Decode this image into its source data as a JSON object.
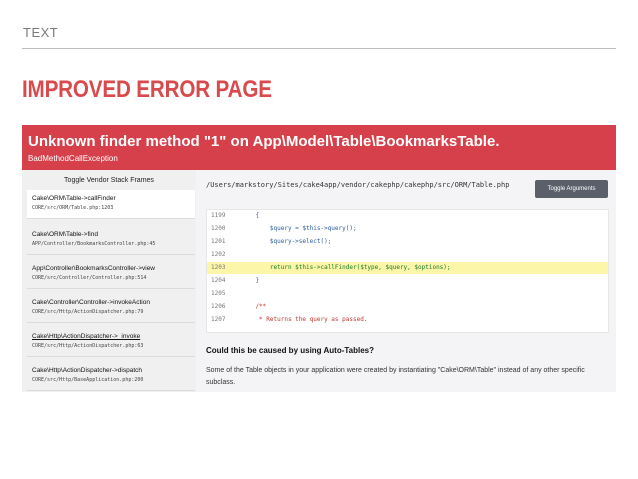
{
  "slide": {
    "tag": "TEXT",
    "title": "IMPROVED ERROR PAGE"
  },
  "error": {
    "title": "Unknown finder method \"1\" on App\\Model\\Table\\BookmarksTable.",
    "type": "BadMethodCallException"
  },
  "sidebar": {
    "toggle_label": "Toggle Vendor Stack Frames",
    "frames": [
      {
        "name": "Cake\\ORM\\Table->callFinder",
        "file": "CORE/src/ORM/Table.php:1203"
      },
      {
        "name": "Cake\\ORM\\Table->find",
        "file": "APP/Controller/BookmarksController.php:45"
      },
      {
        "name": "App\\Controller\\BookmarksController->view",
        "file": "CORE/src/Controller/Controller.php:514"
      },
      {
        "name": "Cake\\Controller\\Controller->invokeAction",
        "file": "CORE/src/Http/ActionDispatcher.php:79"
      },
      {
        "name": "Cake\\Http\\ActionDispatcher->_invoke",
        "file": "CORE/src/Http/ActionDispatcher.php:63"
      },
      {
        "name": "Cake\\Http\\ActionDispatcher->dispatch",
        "file": "CORE/src/Http/BaseApplication.php:200"
      }
    ]
  },
  "main": {
    "file_path": "/Users/markstory/Sites/cake4app/vendor/cakephp/cakephp/src/ORM/Table.php",
    "toggle_args_label": "Toggle Arguments",
    "code": [
      {
        "num": "1199",
        "text": "    {"
      },
      {
        "num": "1200",
        "text": "        $query = $this->query();"
      },
      {
        "num": "1201",
        "text": "        $query->select();"
      },
      {
        "num": "1202",
        "text": ""
      },
      {
        "num": "1203",
        "text": "        return $this->callFinder($type, $query, $options);"
      },
      {
        "num": "1204",
        "text": "    }"
      },
      {
        "num": "1205",
        "text": ""
      },
      {
        "num": "1206",
        "text": "    /**"
      },
      {
        "num": "1207",
        "text": "     * Returns the query as passed."
      }
    ],
    "highlight_line": "1203",
    "cause_title": "Could this be caused by using Auto-Tables?",
    "cause_text": "Some of the Table objects in your application were created by instantiating \"Cake\\ORM\\Table\" instead of any other specific subclass."
  },
  "colors": {
    "brand_red": "#d5404a",
    "title_red": "#d84a4c",
    "highlight": "#fbf6a8",
    "button": "#5a5f6a"
  }
}
